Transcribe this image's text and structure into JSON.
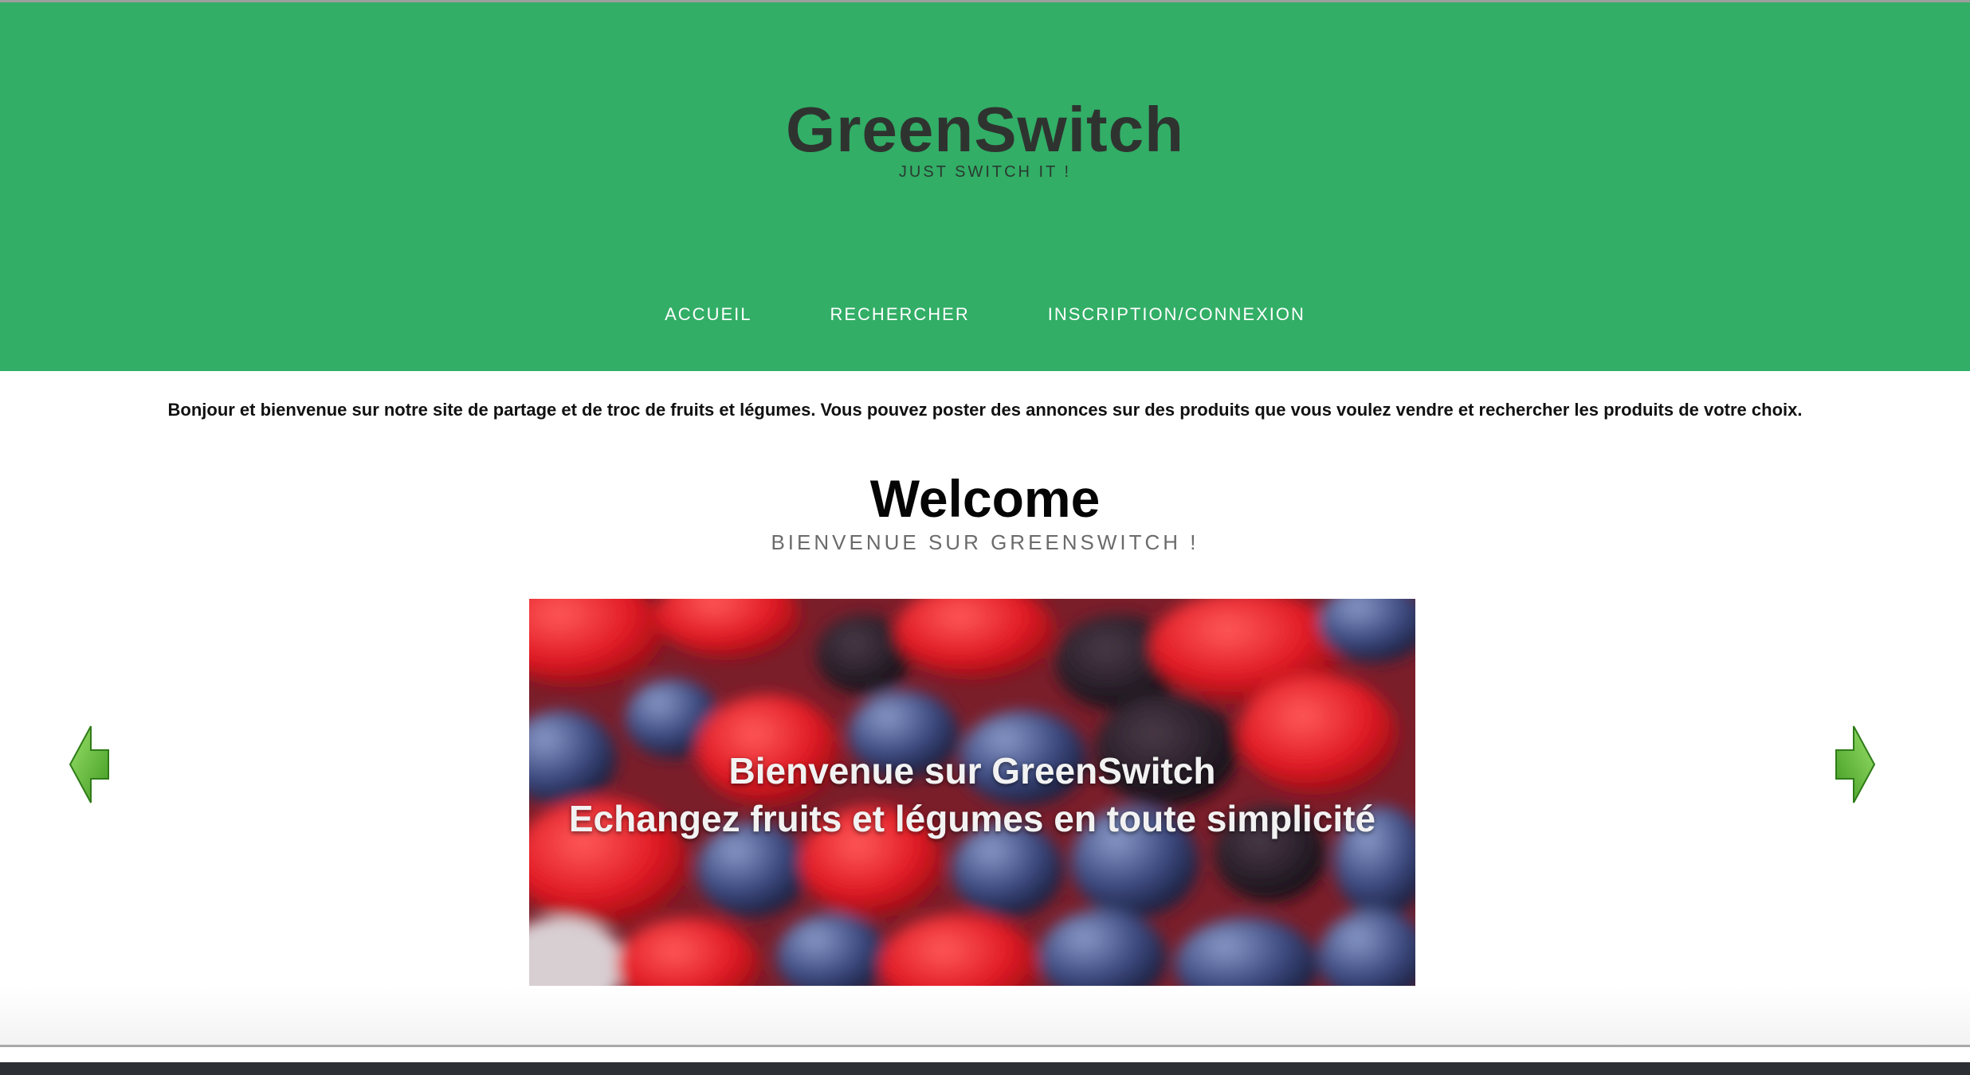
{
  "header": {
    "title": "GreenSwitch",
    "tagline": "JUST SWITCH IT !",
    "background_color": "#32ae66"
  },
  "nav": {
    "items": [
      {
        "label": "ACCUEIL"
      },
      {
        "label": "RECHERCHER"
      },
      {
        "label": "INSCRIPTION/CONNEXION"
      }
    ]
  },
  "intro": {
    "text": "Bonjour et bienvenue sur notre site de partage et de troc de fruits et légumes. Vous pouvez poster des annonces sur des produits que vous voulez vendre et rechercher les produits de votre choix."
  },
  "welcome": {
    "title": "Welcome",
    "subtitle": "BIENVENUE SUR GREENSWITCH !"
  },
  "slider": {
    "caption_line1": "Bienvenue sur GreenSwitch",
    "caption_line2": "Echangez fruits et légumes en toute simplicité",
    "prev_icon": "arrow-left-icon",
    "next_icon": "arrow-right-icon",
    "arrow_color": "#5cb82e"
  }
}
